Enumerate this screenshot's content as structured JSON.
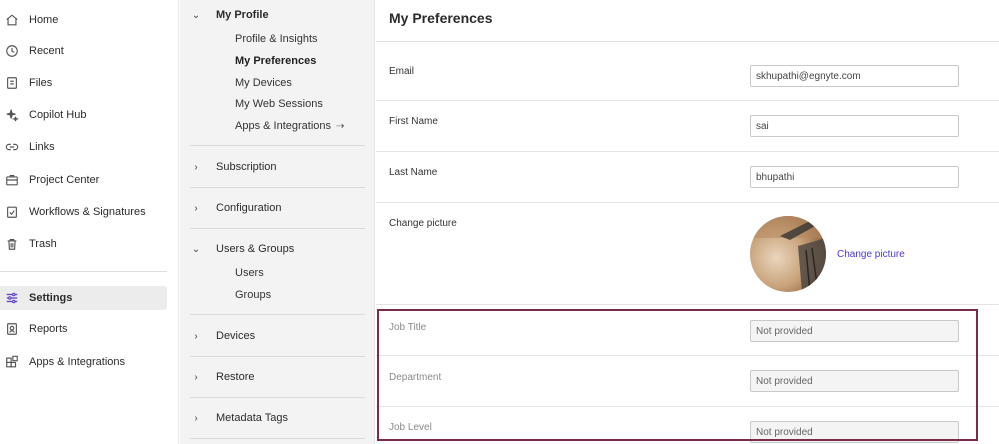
{
  "nav": {
    "items": [
      {
        "label": "Home",
        "icon": "home-icon"
      },
      {
        "label": "Recent",
        "icon": "clock-icon"
      },
      {
        "label": "Files",
        "icon": "file-icon"
      },
      {
        "label": "Copilot Hub",
        "icon": "sparkle-icon"
      },
      {
        "label": "Links",
        "icon": "link-icon"
      },
      {
        "label": "Project Center",
        "icon": "briefcase-icon"
      },
      {
        "label": "Workflows & Signatures",
        "icon": "clipboard-check-icon"
      },
      {
        "label": "Trash",
        "icon": "trash-icon"
      },
      {
        "label": "Settings",
        "icon": "sliders-icon",
        "active": true
      },
      {
        "label": "Reports",
        "icon": "report-icon"
      },
      {
        "label": "Apps & Integrations",
        "icon": "apps-icon"
      }
    ]
  },
  "settings": {
    "my_profile": {
      "label": "My Profile",
      "items": [
        "Profile & Insights",
        "My Preferences",
        "My Devices",
        "My Web Sessions",
        "Apps & Integrations"
      ]
    },
    "subscription": "Subscription",
    "configuration": "Configuration",
    "users_groups": {
      "label": "Users & Groups",
      "items": [
        "Users",
        "Groups"
      ]
    },
    "devices": "Devices",
    "restore": "Restore",
    "metadata_tags": "Metadata Tags"
  },
  "main": {
    "title": "My Preferences",
    "email": {
      "label": "Email",
      "value": "skhupathi@egnyte.com"
    },
    "first_name": {
      "label": "First Name",
      "value": "sai"
    },
    "last_name": {
      "label": "Last Name",
      "value": "bhupathi"
    },
    "picture": {
      "label": "Change picture",
      "link": "Change picture"
    },
    "job_title": {
      "label": "Job Title",
      "value": "Not provided"
    },
    "department": {
      "label": "Department",
      "value": "Not provided"
    },
    "job_level": {
      "label": "Job Level",
      "value": "Not provided"
    }
  },
  "colors": {
    "accent": "#4a3cc7",
    "active_icon": "#5b3cc4",
    "highlight_border": "#7a2a4a"
  }
}
